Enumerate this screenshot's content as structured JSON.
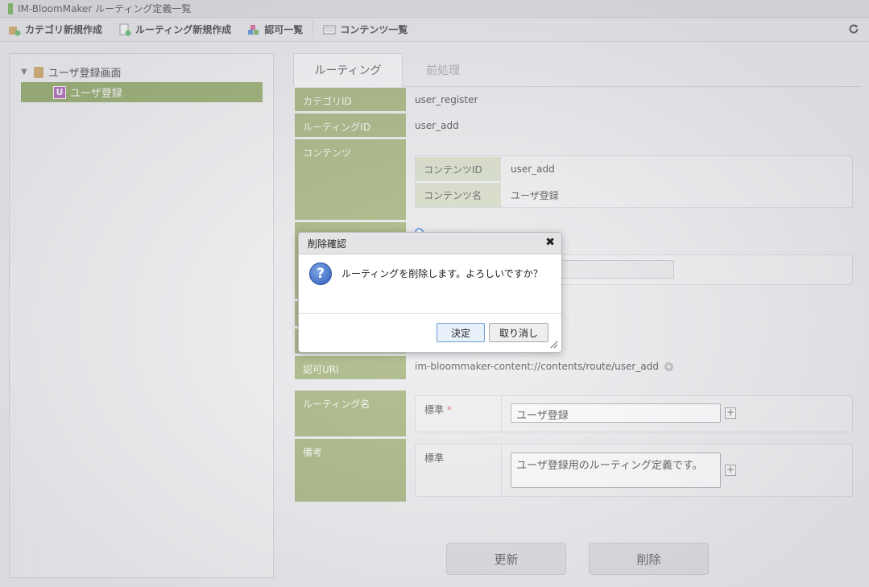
{
  "window": {
    "title": "IM-BloomMaker ルーティング定義一覧"
  },
  "toolbar": {
    "items": [
      {
        "label": "カテゴリ新規作成",
        "icon": "category-add-icon"
      },
      {
        "label": "ルーティング新規作成",
        "icon": "routing-add-icon"
      },
      {
        "label": "認可一覧",
        "icon": "authorization-icon"
      },
      {
        "label": "コンテンツ一覧",
        "icon": "contents-list-icon"
      }
    ],
    "refresh_icon": "refresh-icon"
  },
  "tree": {
    "root_label": "ユーザ登録画面",
    "selected_badge": "U",
    "selected_label": "ユーザ登録"
  },
  "tabs": [
    {
      "label": "ルーティング",
      "active": true
    },
    {
      "label": "前処理",
      "active": false
    }
  ],
  "form": {
    "category_id": {
      "label": "カテゴリID",
      "value": "user_register"
    },
    "routing_id": {
      "label": "ルーティングID",
      "value": "user_add"
    },
    "contents": {
      "label": "コンテンツ",
      "id_label": "コンテンツID",
      "id_value": "user_add",
      "name_label": "コンテンツ名",
      "name_value": "ユーザ登録"
    },
    "auth_uri": {
      "label": "認可URI",
      "value": "im-bloommaker-content://contents/route/user_add"
    },
    "routing_name": {
      "label": "ルーティング名",
      "locale_label": "標準",
      "required_mark": "*",
      "value": "ユーザ登録"
    },
    "remarks": {
      "label": "備考",
      "locale_label": "標準",
      "value": "ユーザ登録用のルーティング定義です。"
    }
  },
  "buttons": {
    "update": "更新",
    "delete": "削除"
  },
  "dialog": {
    "title": "削除確認",
    "message": "ルーティングを削除します。よろしいですか？",
    "ok": "決定",
    "cancel": "取り消し",
    "close_glyph": "✖",
    "question_glyph": "?"
  },
  "colors": {
    "label_bg": "#8fa35c",
    "selected_tree_bg": "#7e9a48",
    "dialog_ok_border": "#6d9ed6"
  }
}
